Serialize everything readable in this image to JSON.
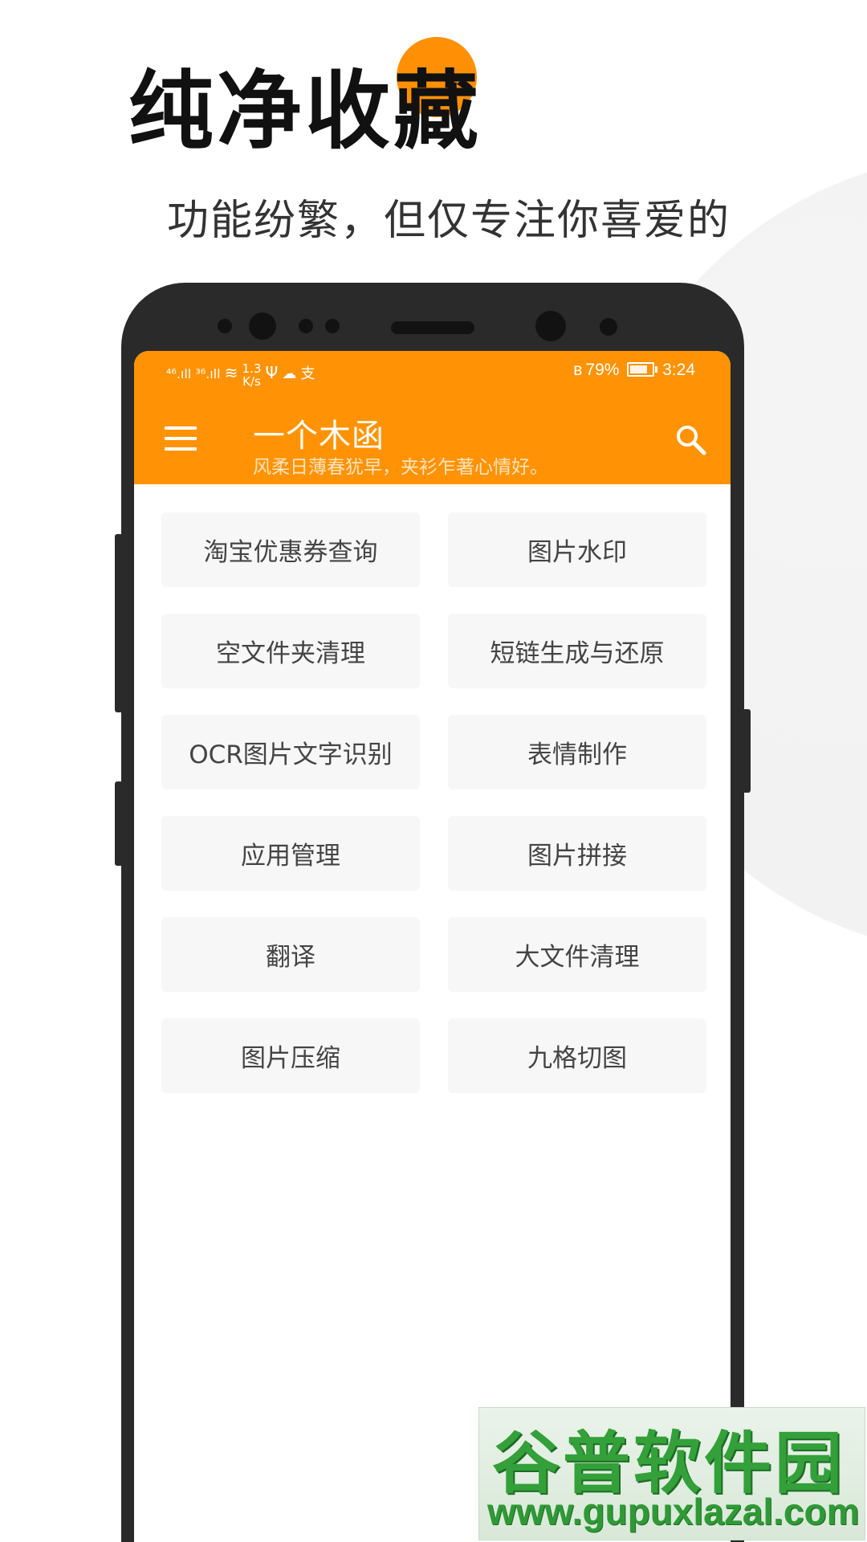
{
  "promo": {
    "headline": "纯净收藏",
    "subheadline": "功能纷繁，但仅专注你喜爱的",
    "accent_color": "#ff9005"
  },
  "status_bar": {
    "signal_1": "⁴⁶.ıll",
    "signal_2": "³⁶.ıll",
    "speed_value": "1.3",
    "speed_unit": "K/s",
    "bluetooth_icon": "bluetooth-icon",
    "battery_text": "79%",
    "battery_level": 0.79,
    "time": "3:24"
  },
  "app_bar": {
    "color": "#ff9305",
    "title": "一个木函",
    "subtitle": "风柔日薄春犹早，夹衫乍著心情好。",
    "menu_icon": "hamburger-menu-icon",
    "search_icon": "search-icon"
  },
  "tools": [
    {
      "label": "淘宝优惠券查询"
    },
    {
      "label": "图片水印"
    },
    {
      "label": "空文件夹清理"
    },
    {
      "label": "短链生成与还原"
    },
    {
      "label": "OCR图片文字识别"
    },
    {
      "label": "表情制作"
    },
    {
      "label": "应用管理"
    },
    {
      "label": "图片拼接"
    },
    {
      "label": "翻译"
    },
    {
      "label": "大文件清理"
    },
    {
      "label": "图片压缩"
    },
    {
      "label": "九格切图"
    }
  ],
  "watermark": {
    "name": "谷普软件园",
    "url": "www.gupuxlazal.com"
  }
}
